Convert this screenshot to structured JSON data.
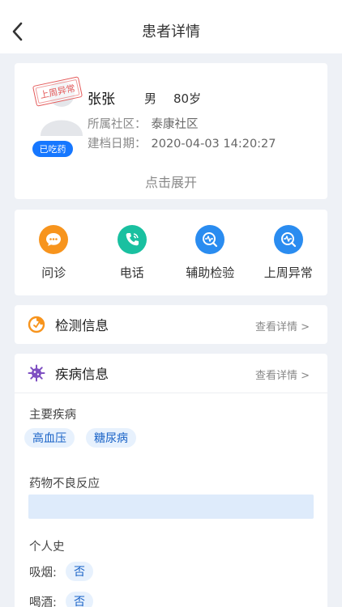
{
  "nav": {
    "title": "患者详情",
    "back_icon": "chevron-left-icon"
  },
  "patient": {
    "stamp": "上周异常",
    "medication_badge": "已吃药",
    "name": "张张",
    "gender": "男",
    "age": "80岁",
    "community_label": "所属社区：",
    "community_value": "泰康社区",
    "created_label": "建档日期：",
    "created_value": "2020-04-03 14:20:27",
    "expand_label": "点击展开"
  },
  "actions": [
    {
      "label": "问诊",
      "icon": "chat-icon",
      "color": "#f7941d"
    },
    {
      "label": "电话",
      "icon": "phone-icon",
      "color": "#19c0a0"
    },
    {
      "label": "辅助检验",
      "icon": "pulse-search-icon",
      "color": "#2a8cf0"
    },
    {
      "label": "上周异常",
      "icon": "pulse-search-icon",
      "color": "#2a8cf0"
    }
  ],
  "monitor": {
    "title": "检测信息",
    "link": "查看详情 >"
  },
  "disease": {
    "title": "疾病信息",
    "link": "查看详情 >",
    "main_label": "主要疾病",
    "main_tags": [
      "高血压",
      "糖尿病"
    ],
    "reaction_label": "药物不良反应",
    "reaction_value": "",
    "personal_label": "个人史",
    "smoking_label": "吸烟:",
    "smoking_value": "否",
    "drinking_label": "喝酒:",
    "drinking_value": "否"
  },
  "colors": {
    "accent": "#1677ff",
    "tag_bg": "#e7f1fd",
    "stamp": "#e45a5a"
  }
}
